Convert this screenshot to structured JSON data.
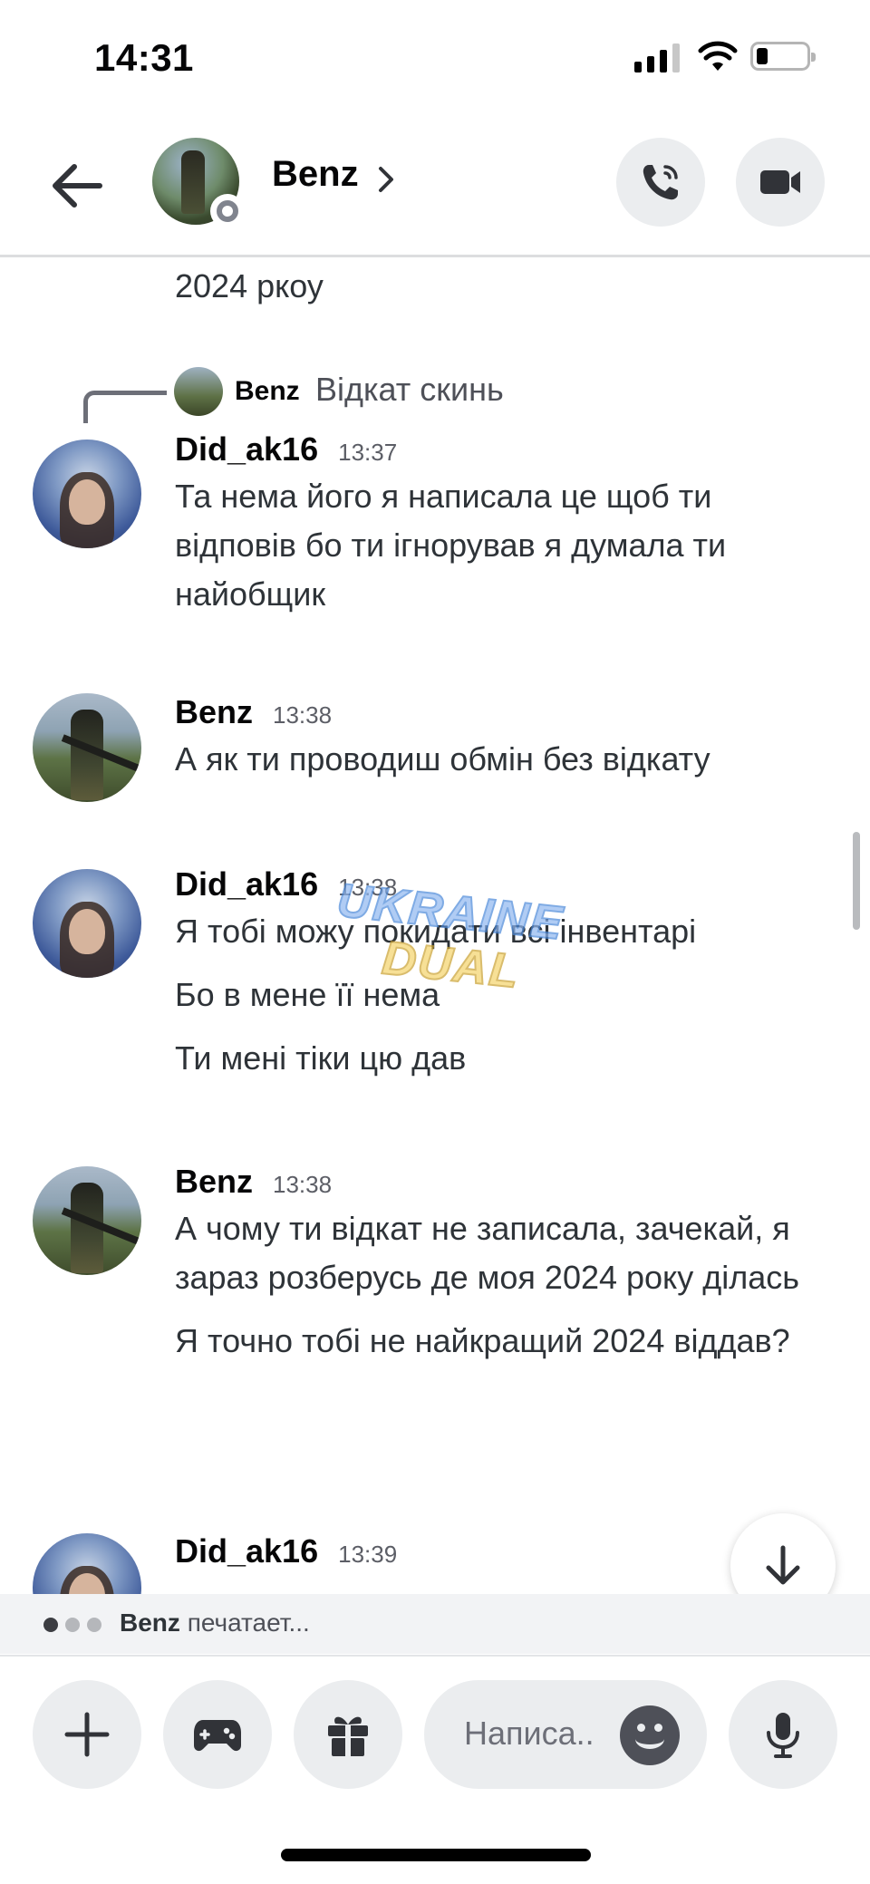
{
  "status_bar": {
    "time": "14:31"
  },
  "header": {
    "name": "Benz"
  },
  "messages": {
    "overflow_line": "2024 ркоу",
    "reply": {
      "author": "Benz",
      "text": "Відкат скинь"
    },
    "groups": [
      {
        "author": "Did_ak16",
        "time": "13:37",
        "lines": [
          "Та нема його я написала це щоб ти відповів бо ти ігнорував я думала ти найобщик"
        ]
      },
      {
        "author": "Benz",
        "time": "13:38",
        "lines": [
          "А як ти проводиш обмін без відкату"
        ]
      },
      {
        "author": "Did_ak16",
        "time": "13:38",
        "lines": [
          "Я тобі можу покидати всі інвентарі",
          "Бо в мене її нема",
          "Ти мені тіки цю дав"
        ]
      },
      {
        "author": "Benz",
        "time": "13:38",
        "lines": [
          "А чому ти відкат не записала, зачекай, я зараз розберусь де моя 2024 року ділась",
          "Я точно тобі не найкращий 2024 віддав?"
        ]
      },
      {
        "author": "Did_ak16",
        "time": "13:39",
        "lines": []
      }
    ]
  },
  "watermark": {
    "line1": "UKRAINE",
    "line2": "DUAL"
  },
  "typing": {
    "user": "Benz",
    "text": "печатает..."
  },
  "composer": {
    "placeholder": "Написа.."
  },
  "colors": {
    "typing_dot_active": "#3c3d42",
    "typing_dot_inactive": "#b5b7bb",
    "icon": "#313338"
  },
  "icons": [
    "back-arrow-icon",
    "chevron-right-icon",
    "phone-icon",
    "video-camera-icon",
    "arrow-down-icon",
    "plus-icon",
    "gamepad-icon",
    "gift-icon",
    "emoji-icon",
    "microphone-icon"
  ]
}
